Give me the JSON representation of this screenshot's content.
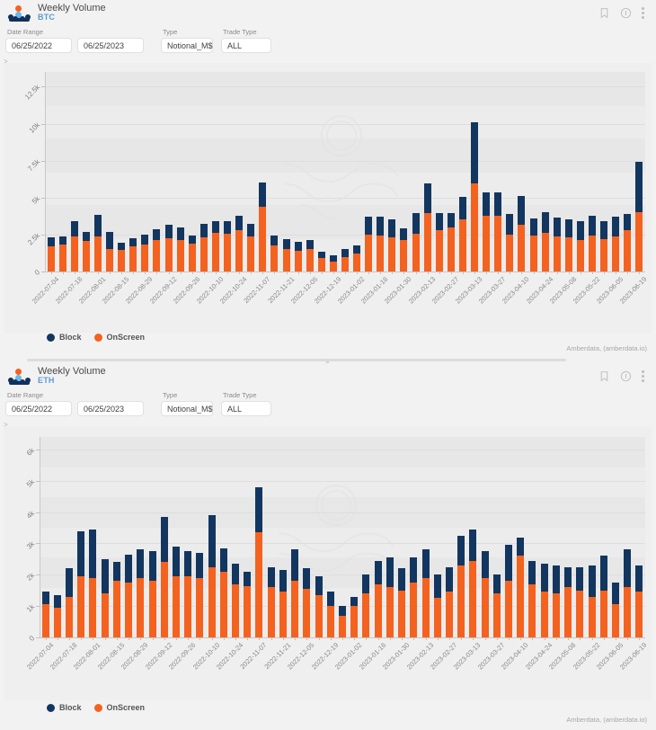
{
  "panels": [
    {
      "id": "btc",
      "title": "Weekly Volume",
      "subtitle": "BTC",
      "icons": {
        "bookmark": "bookmark-icon",
        "info": "info-circle-icon",
        "menu": "kebab-menu-icon"
      },
      "filters": {
        "date_range_label": "Date Range",
        "date_from": "06/25/2022",
        "date_to": "06/25/2023",
        "type_label": "Type",
        "type_value": "Notional_M$",
        "trade_type_label": "Trade Type",
        "trade_type_value": "ALL"
      },
      "expander": ">",
      "legend": [
        {
          "name": "Block",
          "color": "#12365f"
        },
        {
          "name": "OnScreen",
          "color": "#f4621f"
        }
      ],
      "credit": "Amberdata, (amberdata.io)",
      "chart_data": {
        "type": "bar",
        "title": "Weekly Volume BTC",
        "subtitle": "BTC",
        "stacked": true,
        "xlabel": "",
        "ylabel": "",
        "ylim": [
          0,
          13500
        ],
        "yticks": [
          0,
          2500,
          5000,
          7500,
          10000,
          12500
        ],
        "ytick_labels": [
          "0",
          "2.5k",
          "5k",
          "7.5k",
          "10k",
          "12.5k"
        ],
        "grid": true,
        "legend_position": "bottom-left",
        "categories": [
          "2022-07-04",
          "2022-07-11",
          "2022-07-18",
          "2022-07-25",
          "2022-08-01",
          "2022-08-08",
          "2022-08-15",
          "2022-08-22",
          "2022-08-29",
          "2022-09-05",
          "2022-09-12",
          "2022-09-19",
          "2022-09-26",
          "2022-10-03",
          "2022-10-10",
          "2022-10-17",
          "2022-10-24",
          "2022-10-31",
          "2022-11-07",
          "2022-11-14",
          "2022-11-21",
          "2022-11-28",
          "2022-12-05",
          "2022-12-12",
          "2022-12-19",
          "2022-12-26",
          "2023-01-02",
          "2023-01-09",
          "2023-01-16",
          "2023-01-23",
          "2023-01-30",
          "2023-02-06",
          "2023-02-13",
          "2023-02-20",
          "2023-02-27",
          "2023-03-06",
          "2023-03-13",
          "2023-03-20",
          "2023-03-27",
          "2023-04-03",
          "2023-04-10",
          "2023-04-17",
          "2023-04-24",
          "2023-05-01",
          "2023-05-08",
          "2023-05-15",
          "2023-05-22",
          "2023-05-29",
          "2023-06-05",
          "2023-06-12",
          "2023-06-19"
        ],
        "xtick_labels": [
          "2022-07-04",
          "2022-07-18",
          "2022-08-01",
          "2022-08-15",
          "2022-08-29",
          "2022-09-12",
          "2022-09-26",
          "2022-10-10",
          "2022-10-24",
          "2022-11-07",
          "2022-11-21",
          "2022-12-05",
          "2022-12-19",
          "2023-01-02",
          "2023-01-16",
          "2023-01-30",
          "2023-02-13",
          "2023-02-27",
          "2023-03-13",
          "2023-03-27",
          "2023-04-10",
          "2023-04-24",
          "2023-05-08",
          "2023-05-22",
          "2023-06-05",
          "2023-06-19"
        ],
        "series": [
          {
            "name": "OnScreen",
            "color": "#f4621f",
            "values": [
              1700,
              1800,
              2400,
              2050,
              2400,
              1550,
              1450,
              1700,
              1800,
              2100,
              2250,
              2150,
              1900,
              2300,
              2600,
              2550,
              2800,
              2400,
              4400,
              1750,
              1550,
              1400,
              1550,
              900,
              700,
              1000,
              1200,
              2500,
              2450,
              2300,
              2150,
              2550,
              3950,
              2800,
              3000,
              3500,
              5950,
              3750,
              3800,
              2500,
              3150,
              2450,
              2600,
              2400,
              2300,
              2150,
              2450,
              2200,
              2400,
              2800,
              4000
            ]
          },
          {
            "name": "Block",
            "color": "#12365f",
            "values": [
              600,
              600,
              1000,
              650,
              1450,
              1150,
              500,
              550,
              700,
              750,
              900,
              850,
              550,
              900,
              800,
              850,
              950,
              800,
              1650,
              700,
              650,
              600,
              600,
              450,
              400,
              500,
              550,
              1200,
              1250,
              1200,
              800,
              1400,
              2000,
              1150,
              950,
              1550,
              4150,
              1600,
              1550,
              1400,
              1950,
              1150,
              1400,
              1250,
              1200,
              1250,
              1300,
              1200,
              1300,
              1100,
              3450
            ]
          }
        ]
      }
    },
    {
      "id": "eth",
      "title": "Weekly Volume",
      "subtitle": "ETH",
      "icons": {
        "bookmark": "bookmark-icon",
        "info": "info-circle-icon",
        "menu": "kebab-menu-icon"
      },
      "filters": {
        "date_range_label": "Date Range",
        "date_from": "06/25/2022",
        "date_to": "06/25/2023",
        "type_label": "Type",
        "type_value": "Notional_M$",
        "trade_type_label": "Trade Type",
        "trade_type_value": "ALL"
      },
      "expander": ">",
      "legend": [
        {
          "name": "Block",
          "color": "#12365f"
        },
        {
          "name": "OnScreen",
          "color": "#f4621f"
        }
      ],
      "credit": "Amberdata, (amberdata.io)",
      "chart_data": {
        "type": "bar",
        "title": "Weekly Volume ETH",
        "subtitle": "ETH",
        "stacked": true,
        "xlabel": "",
        "ylabel": "",
        "ylim": [
          0,
          6400
        ],
        "yticks": [
          0,
          1000,
          2000,
          3000,
          4000,
          5000,
          6000
        ],
        "ytick_labels": [
          "0",
          "1k",
          "2k",
          "3k",
          "4k",
          "5k",
          "6k"
        ],
        "grid": true,
        "legend_position": "bottom-left",
        "categories": [
          "2022-07-04",
          "2022-07-11",
          "2022-07-18",
          "2022-07-25",
          "2022-08-01",
          "2022-08-08",
          "2022-08-15",
          "2022-08-22",
          "2022-08-29",
          "2022-09-05",
          "2022-09-12",
          "2022-09-19",
          "2022-09-26",
          "2022-10-03",
          "2022-10-10",
          "2022-10-17",
          "2022-10-24",
          "2022-10-31",
          "2022-11-07",
          "2022-11-14",
          "2022-11-21",
          "2022-11-28",
          "2022-12-05",
          "2022-12-12",
          "2022-12-19",
          "2022-12-26",
          "2023-01-02",
          "2023-01-09",
          "2023-01-16",
          "2023-01-23",
          "2023-01-30",
          "2023-02-06",
          "2023-02-13",
          "2023-02-20",
          "2023-02-27",
          "2023-03-06",
          "2023-03-13",
          "2023-03-20",
          "2023-03-27",
          "2023-04-03",
          "2023-04-10",
          "2023-04-17",
          "2023-04-24",
          "2023-05-01",
          "2023-05-08",
          "2023-05-15",
          "2023-05-22",
          "2023-05-29",
          "2023-06-05",
          "2023-06-12",
          "2023-06-19"
        ],
        "xtick_labels": [
          "2022-07-04",
          "2022-07-18",
          "2022-08-01",
          "2022-08-15",
          "2022-08-29",
          "2022-09-12",
          "2022-09-26",
          "2022-10-10",
          "2022-10-24",
          "2022-11-07",
          "2022-11-21",
          "2022-12-05",
          "2022-12-19",
          "2023-01-02",
          "2023-01-16",
          "2023-01-30",
          "2023-02-13",
          "2023-02-27",
          "2023-03-13",
          "2023-03-27",
          "2023-04-10",
          "2023-04-24",
          "2023-05-08",
          "2023-05-22",
          "2023-06-05",
          "2023-06-19"
        ],
        "series": [
          {
            "name": "OnScreen",
            "color": "#f4621f",
            "values": [
              1050,
              950,
              1300,
              1950,
              1900,
              1400,
              1800,
              1750,
              1900,
              1800,
              2400,
              1950,
              1950,
              1900,
              2250,
              2100,
              1700,
              1650,
              3350,
              1600,
              1450,
              1800,
              1550,
              1350,
              1000,
              700,
              1000,
              1400,
              1700,
              1600,
              1500,
              1750,
              1900,
              1250,
              1450,
              2300,
              2450,
              1900,
              1400,
              1800,
              2600,
              1700,
              1450,
              1400,
              1600,
              1500,
              1300,
              1500,
              1050,
              1600,
              1450
            ]
          },
          {
            "name": "Block",
            "color": "#12365f",
            "values": [
              400,
              400,
              900,
              1450,
              1550,
              1100,
              600,
              900,
              900,
              950,
              1450,
              950,
              800,
              800,
              1650,
              750,
              650,
              450,
              1450,
              650,
              700,
              1000,
              650,
              600,
              450,
              300,
              300,
              600,
              750,
              950,
              700,
              800,
              900,
              750,
              800,
              950,
              1000,
              850,
              600,
              1150,
              600,
              750,
              900,
              900,
              650,
              750,
              1000,
              1100,
              700,
              1200,
              850
            ]
          }
        ]
      }
    }
  ]
}
